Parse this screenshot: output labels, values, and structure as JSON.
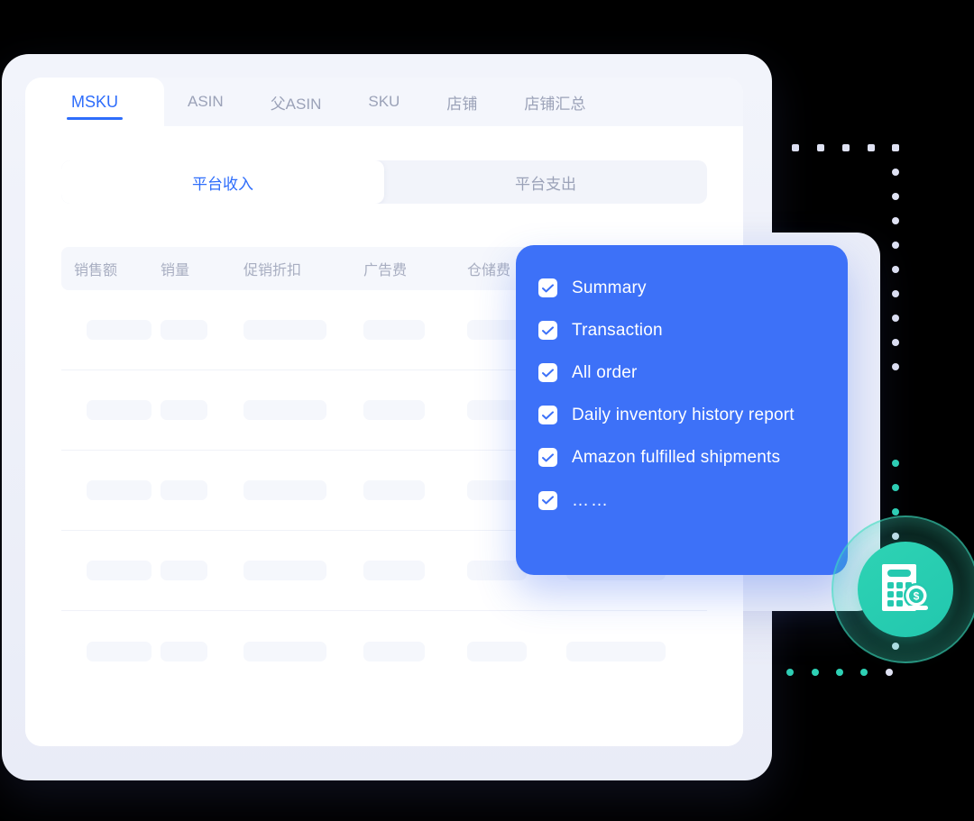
{
  "window": {
    "tabs": [
      {
        "label": "MSKU",
        "active": true
      },
      {
        "label": "ASIN",
        "active": false
      },
      {
        "label": "父ASIN",
        "active": false
      },
      {
        "label": "SKU",
        "active": false
      },
      {
        "label": "店铺",
        "active": false
      },
      {
        "label": "店铺汇总",
        "active": false
      }
    ],
    "segmented": [
      {
        "label": "平台收入",
        "active": true
      },
      {
        "label": "平台支出",
        "active": false
      }
    ],
    "table": {
      "headers": [
        "销售额",
        "销量",
        "促销折扣",
        "广告费",
        "仓储费",
        ""
      ],
      "skeleton_rows": 5
    }
  },
  "checklist_panel": {
    "accent_color": "#3d71f8",
    "items": [
      {
        "label": "Summary",
        "checked": true
      },
      {
        "label": "Transaction",
        "checked": true
      },
      {
        "label": "All order",
        "checked": true
      },
      {
        "label": "Daily inventory history report",
        "checked": true
      },
      {
        "label": "Amazon fulfilled shipments",
        "checked": true
      },
      {
        "label": "……",
        "checked": true
      }
    ]
  },
  "badge": {
    "icon": "calculator-dollar-icon",
    "color": "#2ed3b4"
  },
  "decor": {
    "dot_color": "#dfe2f3",
    "dot_color_teal": "#2ed1b5"
  }
}
